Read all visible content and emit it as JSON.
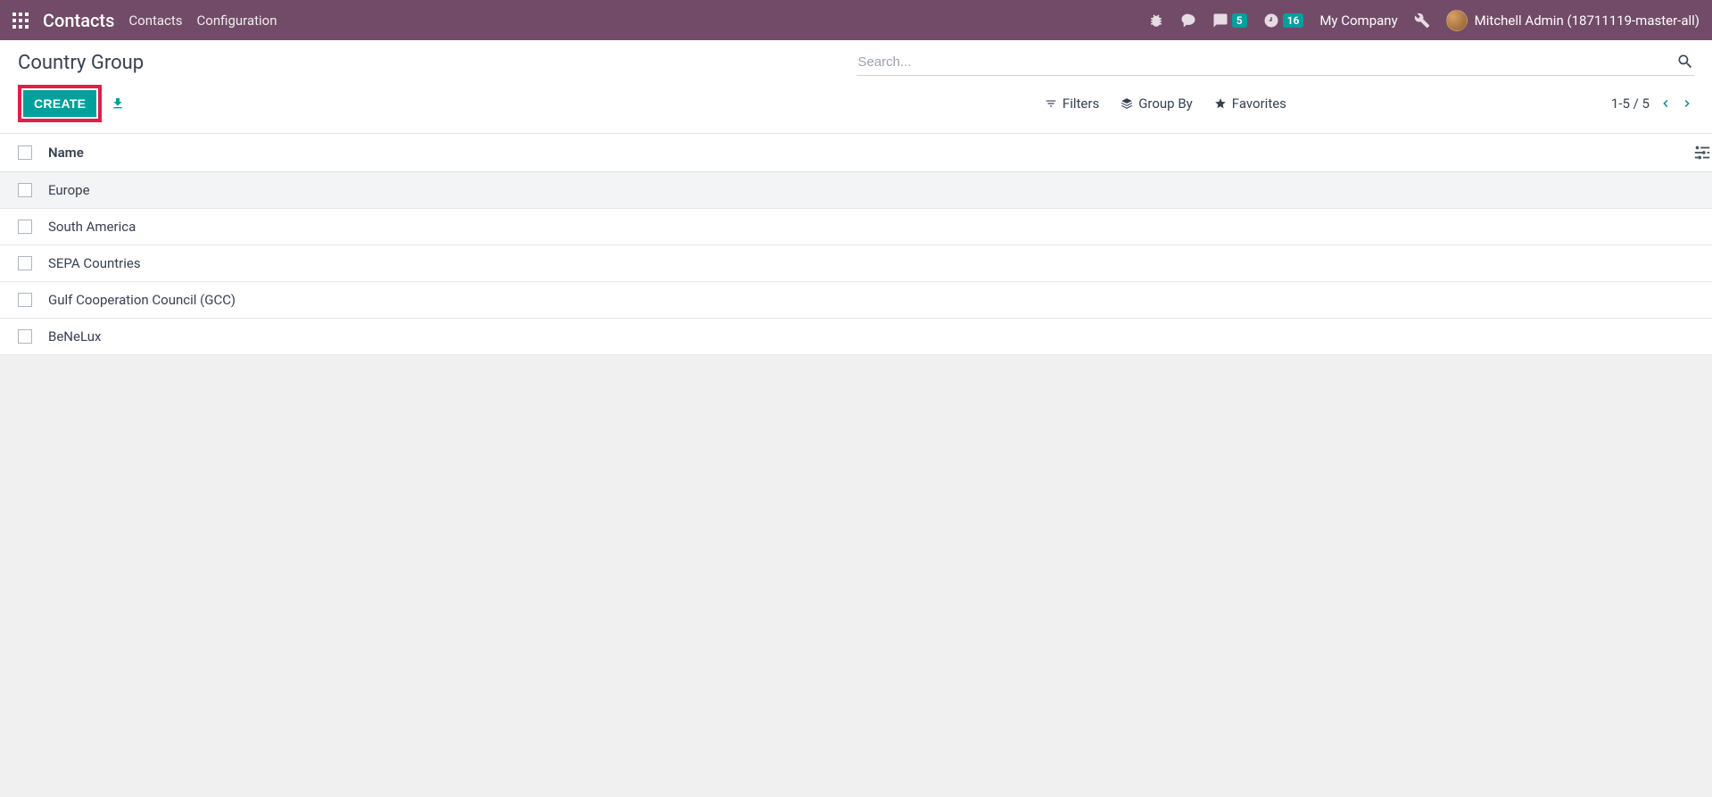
{
  "topnav": {
    "brand": "Contacts",
    "menu": [
      "Contacts",
      "Configuration"
    ],
    "messages_badge": "5",
    "activities_badge": "16",
    "company": "My Company",
    "user": "Mitchell Admin (18711119-master-all)"
  },
  "control_panel": {
    "breadcrumb": "Country Group",
    "search_placeholder": "Search...",
    "create_label": "CREATE",
    "filters_label": "Filters",
    "groupby_label": "Group By",
    "favorites_label": "Favorites",
    "pager_text": "1-5 / 5"
  },
  "table": {
    "header_name": "Name",
    "rows": [
      {
        "name": "Europe"
      },
      {
        "name": "South America"
      },
      {
        "name": "SEPA Countries"
      },
      {
        "name": "Gulf Cooperation Council (GCC)"
      },
      {
        "name": "BeNeLux"
      }
    ]
  }
}
